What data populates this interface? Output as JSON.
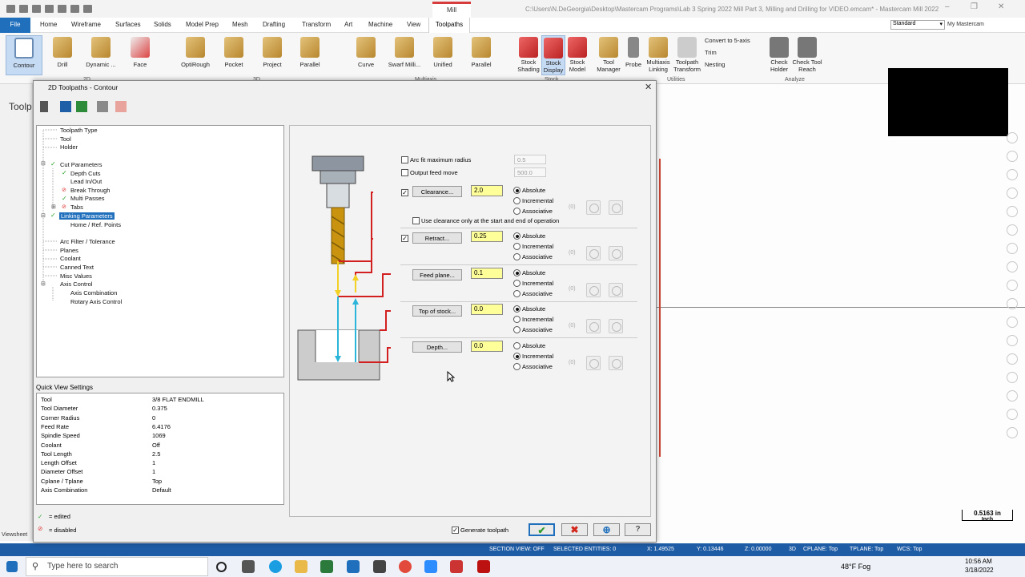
{
  "window": {
    "machine_tab": "Mill",
    "title": "C:\\Users\\N.DeGeorgia\\Desktop\\Mastercam Programs\\Lab 3 Spring 2022 Mill Part 3, Milling and Drilling for VIDEO.emcam* - Mastercam Mill 2022"
  },
  "menu": {
    "file": "File",
    "items": [
      "Home",
      "Wireframe",
      "Surfaces",
      "Solids",
      "Model Prep",
      "Mesh",
      "Drafting",
      "Transform",
      "Art",
      "Machine",
      "View"
    ],
    "active": "Toolpaths",
    "standard": "Standard",
    "my_mastercam": "My Mastercam"
  },
  "ribbon": {
    "buttons": [
      "Contour",
      "Drill",
      "Dynamic ...",
      "Face",
      "OptiRough",
      "Pocket",
      "Project",
      "Parallel",
      "Curve",
      "Swarf Milli...",
      "Unified",
      "Parallel",
      "Stock Shading",
      "Stock Display",
      "Stock Model",
      "Tool Manager",
      "Probe",
      "Multiaxis Linking",
      "Toolpath Transform",
      "Check Holder",
      "Check Tool Reach"
    ],
    "small": [
      "Convert to 5-axis",
      "Trim",
      "Nesting"
    ],
    "groups": [
      "2D",
      "3D",
      "Multiaxis",
      "Stock",
      "Utilities",
      "Analyze"
    ]
  },
  "background": {
    "panel_title": "Toolp",
    "scale_value": "0.5163 in",
    "scale_unit": "Inch",
    "viewsheet": "Viewsheet"
  },
  "dialog": {
    "title": "2D Toolpaths - Contour",
    "tree": {
      "items": [
        "Toolpath Type",
        "Tool",
        "Holder",
        "Cut Parameters",
        "Depth Cuts",
        "Lead In/Out",
        "Break Through",
        "Multi Passes",
        "Tabs",
        "Linking Parameters",
        "Home / Ref. Points",
        "Arc Filter / Tolerance",
        "Planes",
        "Coolant",
        "Canned Text",
        "Misc Values",
        "Axis Control",
        "Axis Combination",
        "Rotary Axis Control"
      ]
    },
    "quick_view": {
      "label": "Quick View Settings",
      "rows": [
        {
          "k": "Tool",
          "v": "3/8 FLAT ENDMILL"
        },
        {
          "k": "Tool Diameter",
          "v": "0.375"
        },
        {
          "k": "Corner Radius",
          "v": "0"
        },
        {
          "k": "Feed Rate",
          "v": "6.4176"
        },
        {
          "k": "Spindle Speed",
          "v": "1069"
        },
        {
          "k": "Coolant",
          "v": "Off"
        },
        {
          "k": "Tool Length",
          "v": "2.5"
        },
        {
          "k": "Length Offset",
          "v": "1"
        },
        {
          "k": "Diameter Offset",
          "v": "1"
        },
        {
          "k": "Cplane / Tplane",
          "v": "Top"
        },
        {
          "k": "Axis Combination",
          "v": "Default"
        }
      ]
    },
    "legend": {
      "edited": "= edited",
      "disabled": "= disabled"
    },
    "params": {
      "arc_fit_label": "Arc fit maximum radius",
      "arc_fit_value": "0.5",
      "output_feed_label": "Output feed move",
      "output_feed_value": "500.0",
      "use_clearance_label": "Use clearance only at the start and end of operation",
      "absolute": "Absolute",
      "incremental": "Incremental",
      "associative": "Associative",
      "zero": "(0)",
      "rows": [
        {
          "label": "Clearance...",
          "value": "2.0"
        },
        {
          "label": "Retract...",
          "value": "0.25"
        },
        {
          "label": "Feed plane...",
          "value": "0.1"
        },
        {
          "label": "Top of stock...",
          "value": "0.0"
        },
        {
          "label": "Depth...",
          "value": "0.0"
        }
      ]
    },
    "generate_toolpath": "Generate toolpath"
  },
  "statusbar": {
    "section_view": "SECTION VIEW: OFF",
    "selected": "SELECTED ENTITIES: 0",
    "x": "X:  1.49525",
    "y": "Y:  0.13446",
    "z": "Z:  0.00000",
    "mode": "3D",
    "cplane": "CPLANE: Top",
    "tplane": "TPLANE: Top",
    "wcs": "WCS: Top"
  },
  "taskbar": {
    "search_placeholder": "Type here to search",
    "weather": "48°F  Fog",
    "time": "10:56 AM",
    "date": "3/18/2022"
  },
  "colors": {
    "accent": "#1f6fbd",
    "field_yellow": "#ffff99",
    "tool_gold": "#c9930f",
    "path_red": "#d21f1f",
    "path_cyan": "#2bb5d9"
  }
}
